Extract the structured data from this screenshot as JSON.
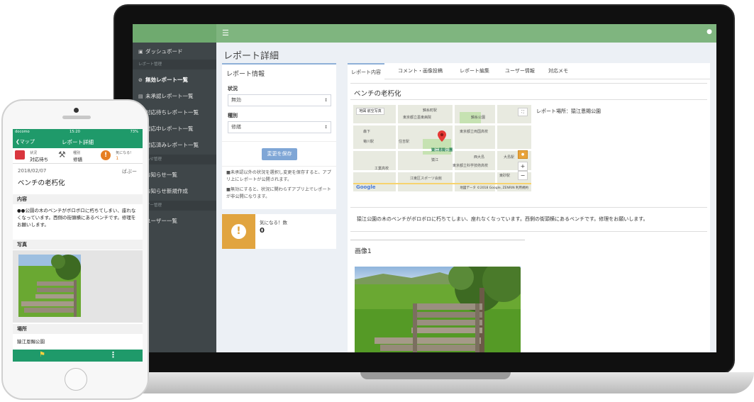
{
  "desktop": {
    "page_title": "レポート詳細",
    "sidebar": {
      "items": [
        {
          "label": "ダッシュボード",
          "icon": "dashboard-icon"
        },
        {
          "label": "レポート管理",
          "header": true
        },
        {
          "label": "無効レポート一覧",
          "icon": "ban-icon",
          "active": true
        },
        {
          "label": "未承認レポート一覧",
          "icon": "inbox-icon"
        },
        {
          "label": "対応待ちレポート一覧",
          "icon": "clock-icon"
        },
        {
          "label": "対応中レポート一覧",
          "icon": "wrench-icon"
        },
        {
          "label": "対応済みレポート一覧",
          "icon": "check-icon"
        },
        {
          "label": "お知らせ管理",
          "header": true
        },
        {
          "label": "お知らせ一覧",
          "icon": "list-icon"
        },
        {
          "label": "お知らせ新規作成",
          "icon": "edit-icon"
        },
        {
          "label": "ユーザー管理",
          "header": true
        },
        {
          "label": "ユーザー一覧",
          "icon": "user-icon"
        }
      ]
    },
    "report_info": {
      "title": "レポート情報",
      "status_label": "状況",
      "status_value": "無効",
      "type_label": "種別",
      "type_value": "修繕",
      "save_button": "変更を保存",
      "note1": "■未承認以外の状況を選択し変更を保存すると、アプリ上にレポートが公開されます。",
      "note2": "■無効にすると、状況に関わらずアプリ上でレポートが非公開になります。"
    },
    "like": {
      "label": "気になる！数",
      "count": "0"
    },
    "tabs": [
      "レポート内容",
      "コメント・画像投稿",
      "レポート編集",
      "ユーザー情報",
      "対応メモ"
    ],
    "report": {
      "name": "ベンチの老朽化",
      "location": "レポート場所：猿江恩賜公園",
      "description": "猿江公園の木のベンチがボロボロに朽ちてしまい、座れなくなっています。西側の街頭横にあるベンチです。修理をお願いします。",
      "image_heading": "画像1"
    },
    "map": {
      "type_buttons": [
        "地図",
        "航空写真"
      ],
      "pin_label": "猿江恩賜公園",
      "labels": [
        "錦糸町駅",
        "東京都立墨東病院",
        "錦糸公園",
        "東京都立両国高校",
        "住吉駅",
        "西大島",
        "大島駅",
        "東京都立科学技術高校",
        "猿江",
        "工業高校",
        "江東区スポーツ会館",
        "東砂駅",
        "菊川駅",
        "森下"
      ],
      "zoom_in": "+",
      "zoom_out": "−",
      "copyright": "地図データ ©2018 Google, ZENRIN  利用規約",
      "logo": "Google"
    }
  },
  "mobile": {
    "status": {
      "carrier": "docomo",
      "time": "15:20",
      "battery": "73%"
    },
    "back_label": "マップ",
    "title": "レポート詳細",
    "badges": [
      {
        "small": "状況",
        "big": "対応待ち",
        "color": "#d9363e"
      },
      {
        "small": "種別",
        "big": "修繕",
        "color": "#555555"
      },
      {
        "small": "気になる!",
        "big": "1",
        "color": "#e67e22"
      }
    ],
    "date": "2018/02/07",
    "author": "ばぶー",
    "report_title": "ベンチの老朽化",
    "content_heading": "内容",
    "content": "●●公園の木のベンチがボロボロに朽ちてしまい、座れなくなっています。西側の街頭横にあるベンチです。修理をお願いします。",
    "photo_heading": "写真",
    "place_heading": "場所",
    "place": "猿江恩賜公園"
  },
  "colors": {
    "accent_green": "#7fb57f",
    "app_green": "#1f9a6a",
    "like_orange": "#e1a43f",
    "button_blue": "#7fa6d6"
  }
}
